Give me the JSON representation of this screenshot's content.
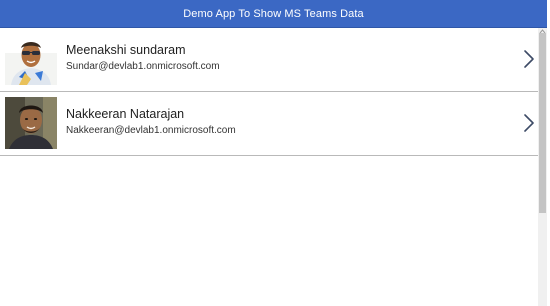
{
  "header": {
    "title": "Demo App To Show MS Teams Data",
    "background": "#3b68c4"
  },
  "users": [
    {
      "name": "Meenakshi sundaram",
      "email": "Sundar@devlab1.onmicrosoft.com",
      "avatar_icon": "user-photo-icon"
    },
    {
      "name": "Nakkeeran Natarajan",
      "email": "Nakkeeran@devlab1.onmicrosoft.com",
      "avatar_icon": "user-photo-icon"
    }
  ]
}
